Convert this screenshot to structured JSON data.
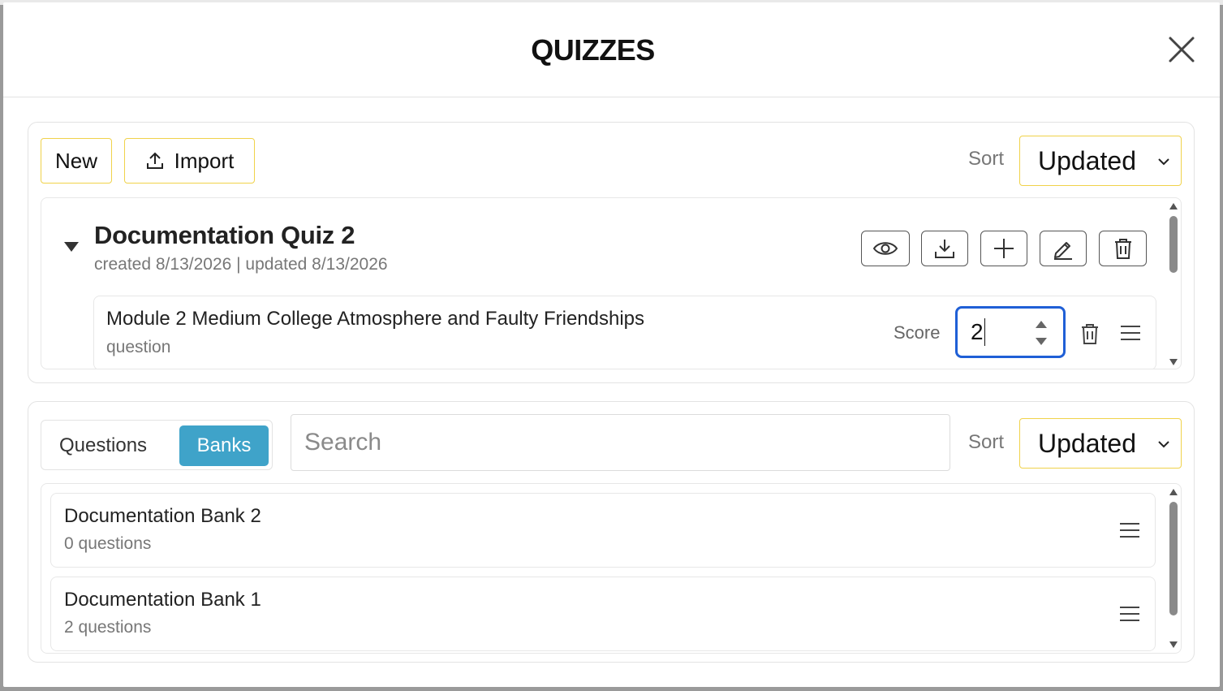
{
  "modal": {
    "title": "QUIZZES"
  },
  "quizzes_panel": {
    "new_label": "New",
    "import_label": "Import",
    "sort_label": "Sort",
    "sort_value": "Updated",
    "quiz": {
      "title": "Documentation Quiz 2",
      "meta": "created 8/13/2026 | updated 8/13/2026",
      "actions": [
        "eye-icon",
        "download-icon",
        "plus-icon",
        "pencil-icon",
        "trash-icon"
      ],
      "question": {
        "title": "Module 2 Medium College Atmosphere and Faulty Friendships",
        "type": "question",
        "score_label": "Score",
        "score_value": "2"
      }
    }
  },
  "library_panel": {
    "tabs": {
      "questions": "Questions",
      "banks": "Banks",
      "active": "Banks"
    },
    "search_placeholder": "Search",
    "sort_label": "Sort",
    "sort_value": "Updated",
    "banks": [
      {
        "name": "Documentation Bank 2",
        "count": "0 questions"
      },
      {
        "name": "Documentation Bank 1",
        "count": "2 questions"
      }
    ]
  },
  "colors": {
    "accent_border": "#f0d24a",
    "focus_blue": "#1f5fd6",
    "tab_active": "#3fa3c9"
  }
}
